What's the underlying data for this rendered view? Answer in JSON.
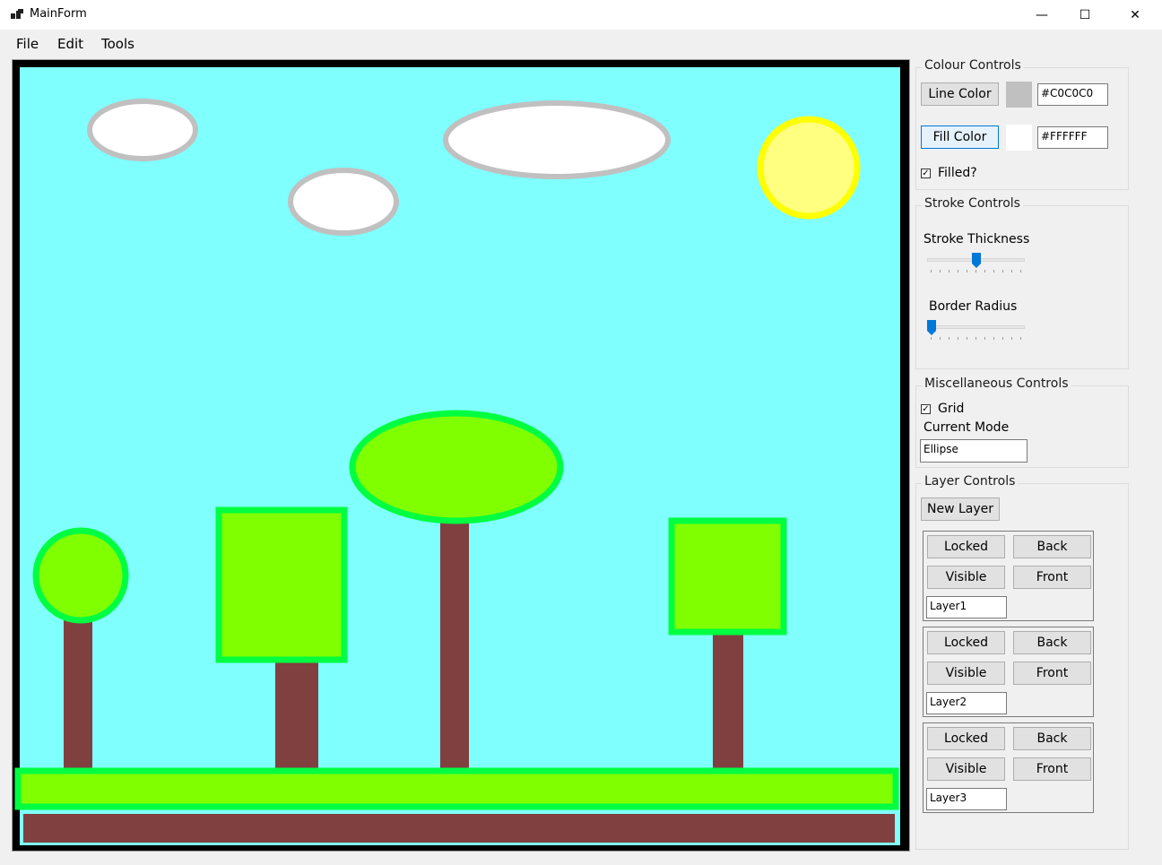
{
  "window": {
    "title": "MainForm",
    "minimize": "—",
    "maximize": "☐",
    "close": "✕"
  },
  "menu": [
    {
      "label": "File"
    },
    {
      "label": "Edit"
    },
    {
      "label": "Tools"
    }
  ],
  "colour_controls": {
    "title": "Colour Controls",
    "line_color_label": "Line Color",
    "line_color_value": "#C0C0C0",
    "line_color_swatch": "#c0c0c0",
    "fill_color_label": "Fill Color",
    "fill_color_value": "#FFFFFF",
    "fill_color_swatch": "#ffffff",
    "filled_label": "Filled?",
    "filled_checked": true
  },
  "stroke_controls": {
    "title": "Stroke Controls",
    "stroke_thickness_label": "Stroke Thickness",
    "stroke_thickness_fraction": 0.5,
    "border_radius_label": "Border Radius",
    "border_radius_fraction": 0.0
  },
  "misc_controls": {
    "title": "Miscellaneous Controls",
    "grid_label": "Grid",
    "grid_checked": true,
    "current_mode_label": "Current Mode",
    "current_mode_value": "Ellipse"
  },
  "layer_controls": {
    "title": "Layer Controls",
    "new_layer_label": "New Layer",
    "layers": [
      {
        "name": "Layer1",
        "locked_label": "Locked",
        "back_label": "Back",
        "visible_label": "Visible",
        "front_label": "Front"
      },
      {
        "name": "Layer2",
        "locked_label": "Locked",
        "back_label": "Back",
        "visible_label": "Visible",
        "front_label": "Front"
      },
      {
        "name": "Layer3",
        "locked_label": "Locked",
        "back_label": "Back",
        "visible_label": "Visible",
        "front_label": "Front"
      }
    ]
  },
  "colors": {
    "sky": "#80ffff",
    "cloud_fill": "#ffffff",
    "cloud_stroke": "#c0c0c0",
    "sun_fill": "#ffff80",
    "sun_stroke": "#ffff00",
    "foliage_fill": "#80ff00",
    "foliage_stroke": "#00ff40",
    "trunk": "#804040",
    "border": "#000000",
    "accent": "#0078d7"
  }
}
